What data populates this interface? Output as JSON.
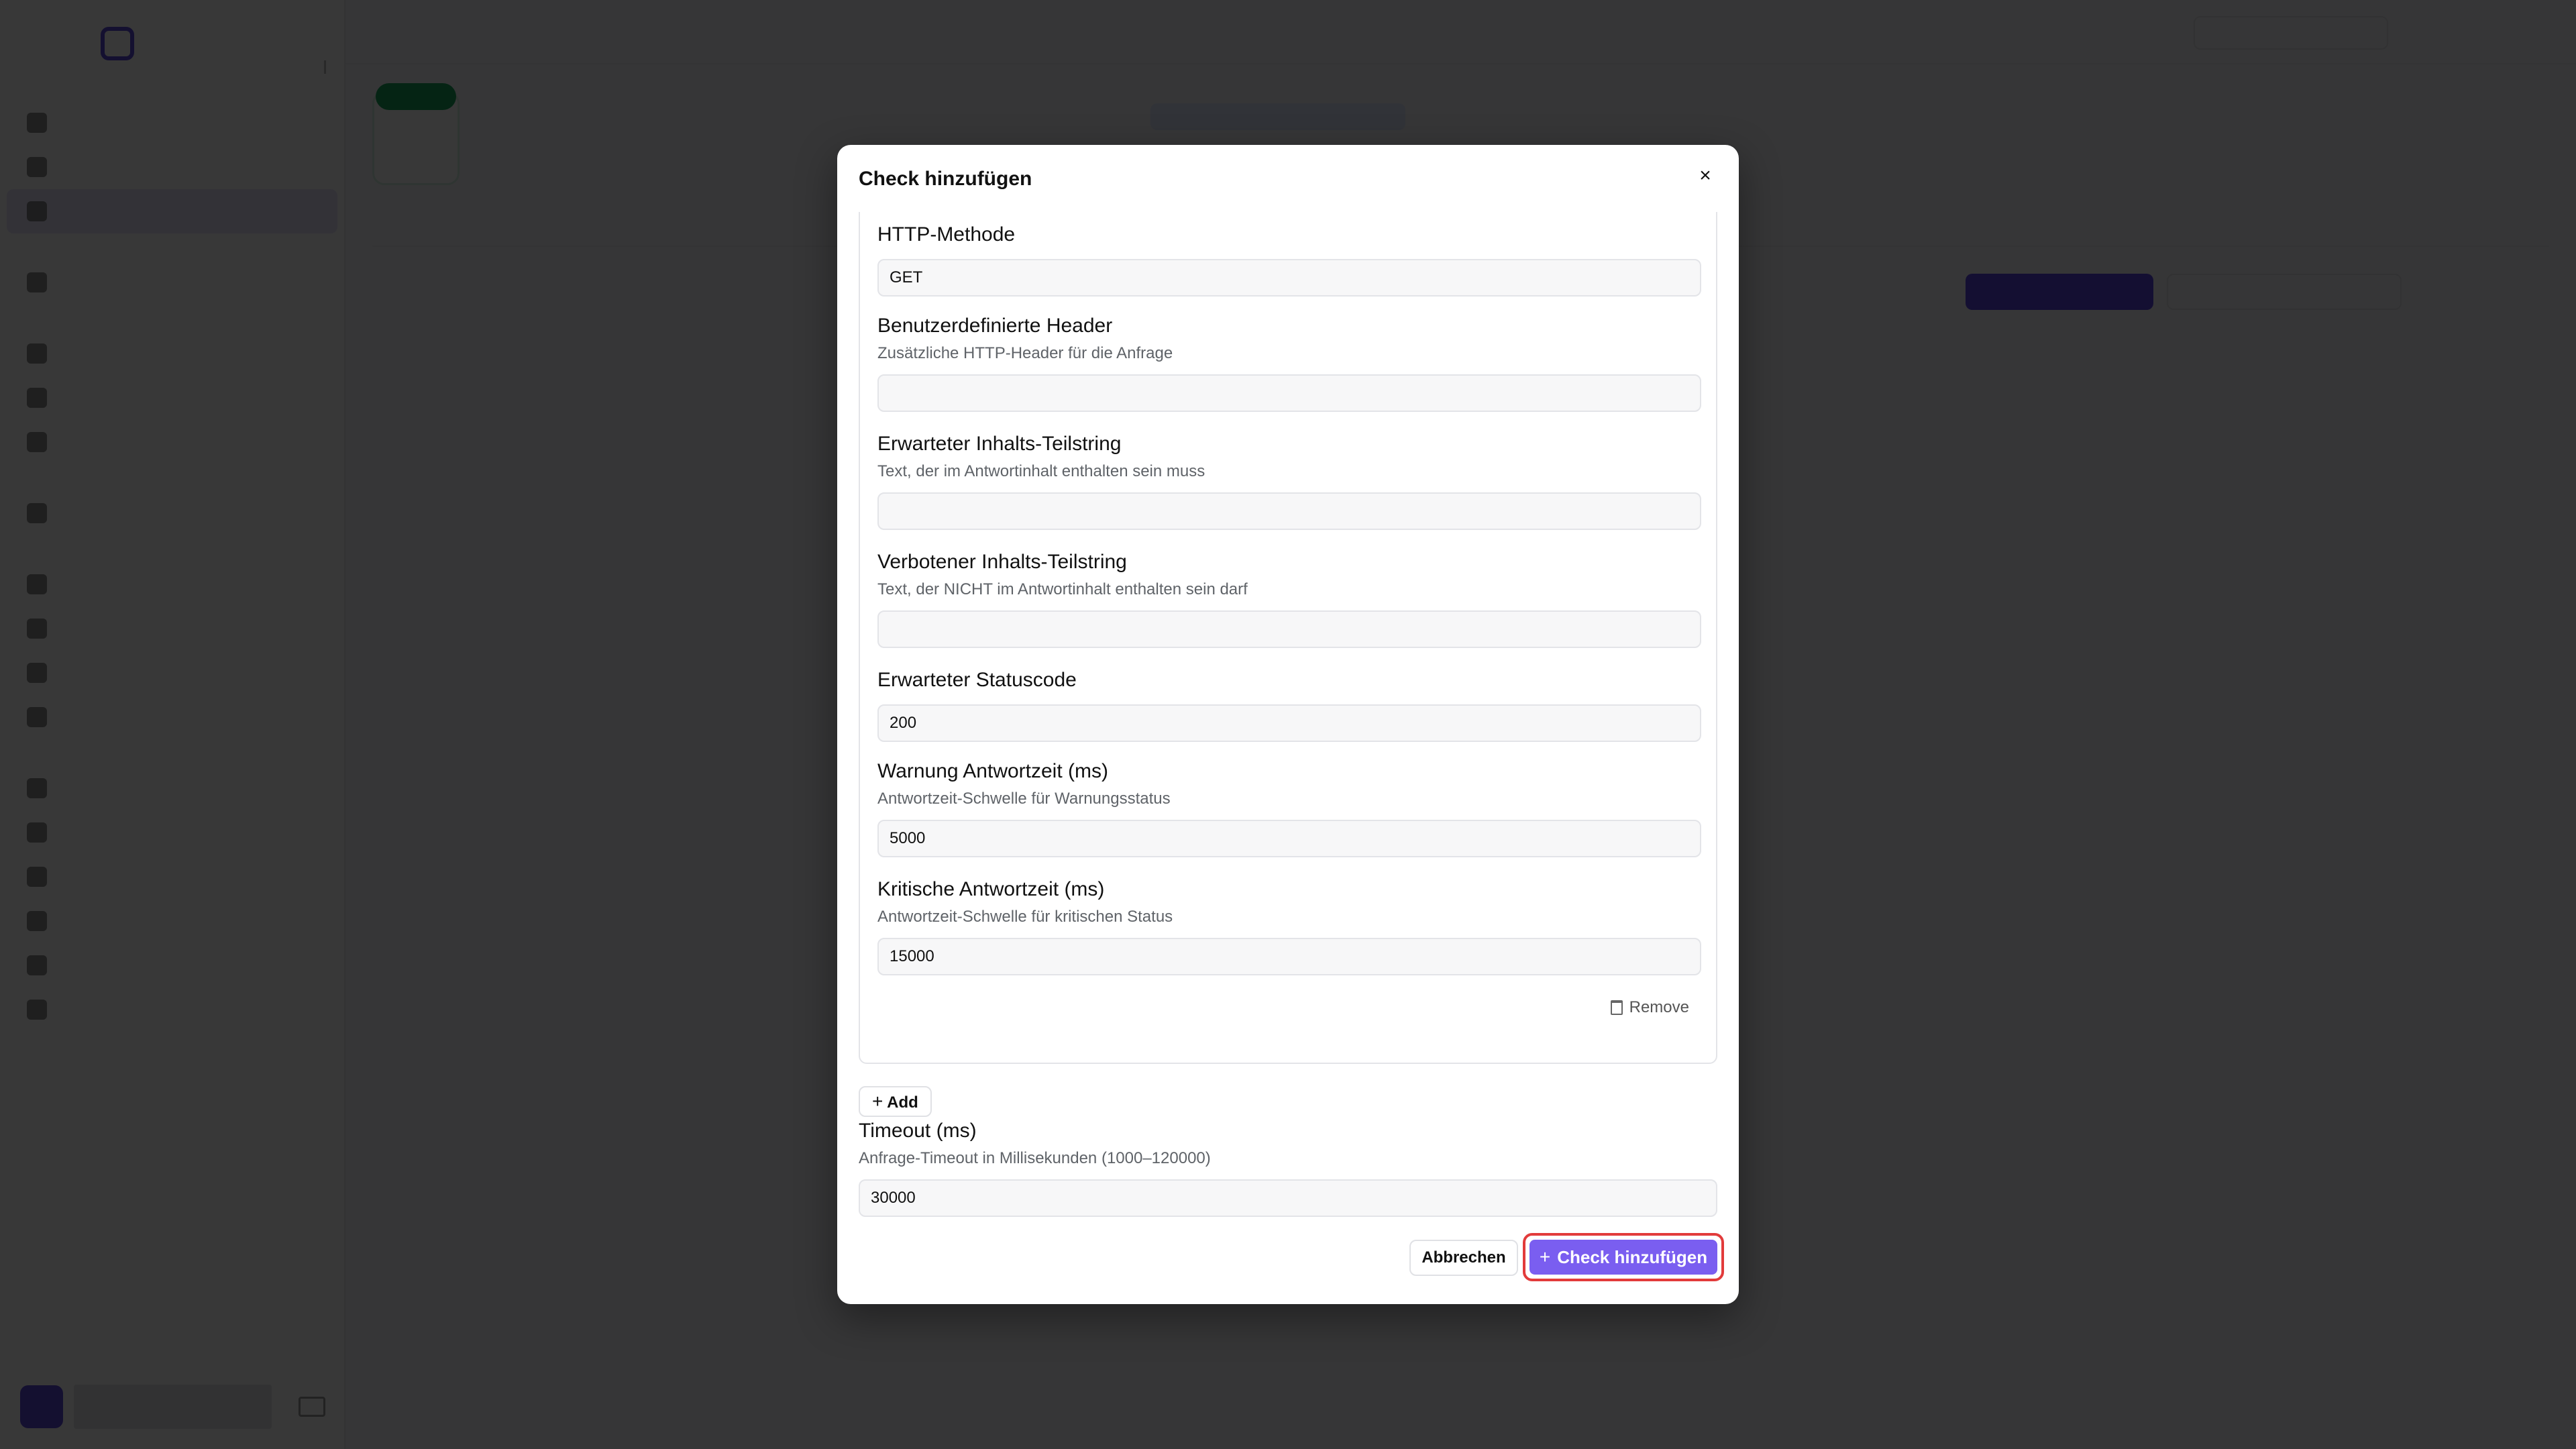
{
  "modal": {
    "title": "Check hinzufügen",
    "close_icon": "×",
    "fields": [
      {
        "label": "HTTP-Methode",
        "description": "",
        "value": "GET"
      },
      {
        "label": "Benutzerdefinierte Header",
        "description": "Zusätzliche HTTP-Header für die Anfrage",
        "value": ""
      },
      {
        "label": "Erwarteter Inhalts-Teilstring",
        "description": "Text, der im Antwortinhalt enthalten sein muss",
        "value": ""
      },
      {
        "label": "Verbotener Inhalts-Teilstring",
        "description": "Text, der NICHT im Antwortinhalt enthalten sein darf",
        "value": ""
      },
      {
        "label": "Erwarteter Statuscode",
        "description": "",
        "value": "200"
      },
      {
        "label": "Warnung Antwortzeit (ms)",
        "description": "Antwortzeit-Schwelle für Warnungsstatus",
        "value": "5000"
      },
      {
        "label": "Kritische Antwortzeit (ms)",
        "description": "Antwortzeit-Schwelle für kritischen Status",
        "value": "15000"
      }
    ],
    "remove_label": "Remove",
    "add_label": "Add",
    "timeout": {
      "label": "Timeout (ms)",
      "description": "Anfrage-Timeout in Millisekunden (1000–120000)",
      "value": "30000"
    },
    "cancel_label": "Abbrechen",
    "submit_label": "Check hinzufügen",
    "plus_icon": "+"
  },
  "colors": {
    "accent": "#7a5ef0",
    "highlight": "#e23b3b",
    "overlay": "rgba(0,0,0,0.78)"
  }
}
